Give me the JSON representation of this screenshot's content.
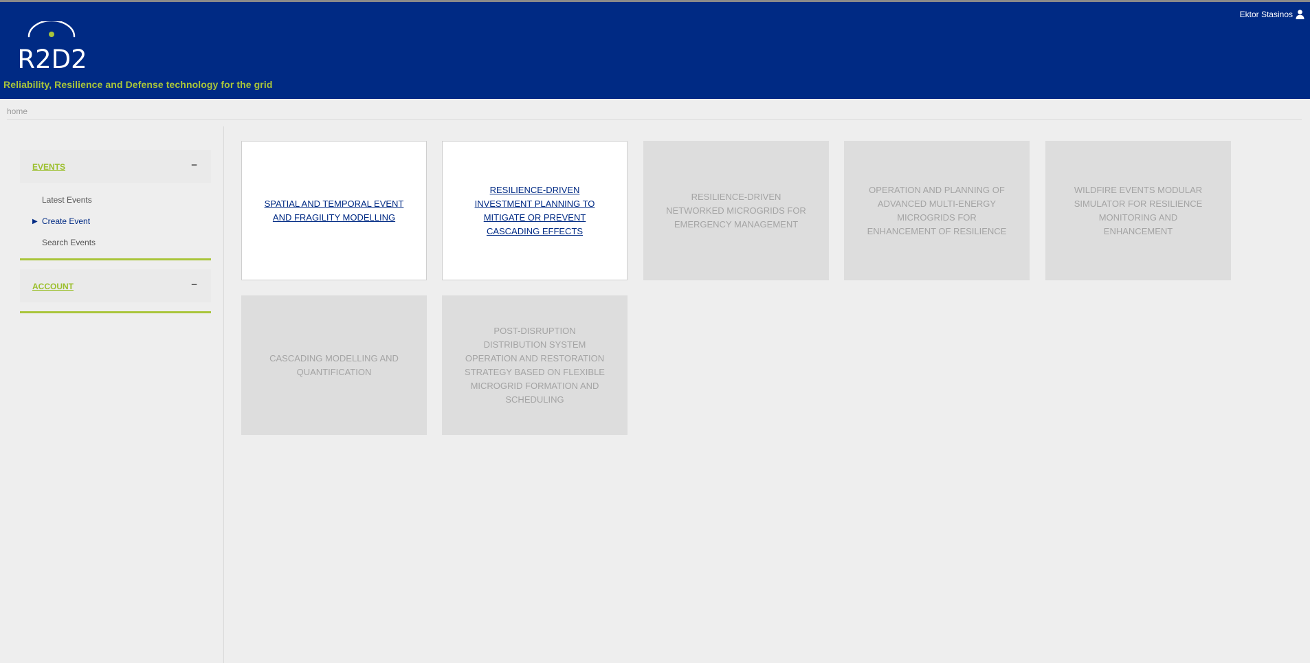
{
  "header": {
    "logo_text": "R2D2",
    "tagline": "Reliability, Resilience and Defense technology for the grid",
    "user_name": "Ektor Stasinos",
    "brand_color": "#002a84",
    "accent_color": "#a9c53a"
  },
  "breadcrumb": {
    "label": "home"
  },
  "sidebar": {
    "sections": [
      {
        "title": "EVENTS",
        "toggle": "−",
        "items": [
          {
            "label": "Latest Events"
          },
          {
            "label": "Create Event",
            "active_marker": "▶"
          },
          {
            "label": "Search Events"
          }
        ]
      },
      {
        "title": "ACCOUNT",
        "toggle": "−"
      }
    ]
  },
  "tiles": [
    {
      "label": "SPATIAL AND TEMPORAL EVENT AND FRAGILITY MODELLING",
      "enabled": true
    },
    {
      "label": "RESILIENCE-DRIVEN INVESTMENT PLANNING TO MITIGATE OR PREVENT CASCADING EFFECTS",
      "enabled": true
    },
    {
      "label": "RESILIENCE-DRIVEN NETWORKED MICROGRIDS FOR EMERGENCY MANAGEMENT",
      "enabled": false
    },
    {
      "label": "OPERATION AND PLANNING OF ADVANCED MULTI-ENERGY MICROGRIDS FOR ENHANCEMENT OF RESILIENCE",
      "enabled": false
    },
    {
      "label": "WILDFIRE EVENTS MODULAR SIMULATOR FOR RESILIENCE MONITORING AND ENHANCEMENT",
      "enabled": false
    },
    {
      "label": "CASCADING MODELLING AND QUANTIFICATION",
      "enabled": false
    },
    {
      "label": "POST-DISRUPTION DISTRIBUTION SYSTEM OPERATION AND RESTORATION STRATEGY BASED ON FLEXIBLE MICROGRID FORMATION AND SCHEDULING",
      "enabled": false
    }
  ]
}
